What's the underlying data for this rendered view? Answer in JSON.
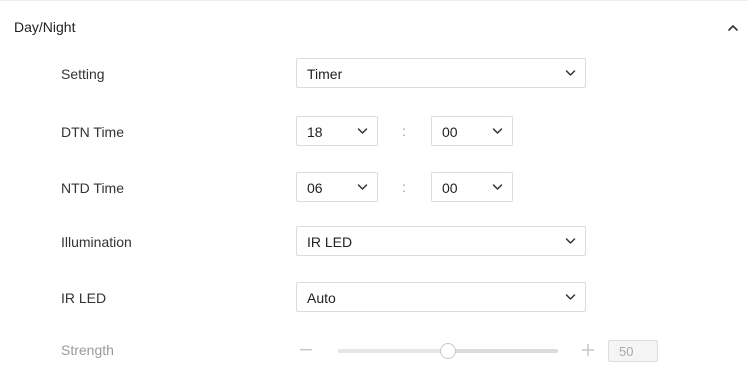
{
  "section": {
    "title": "Day/Night",
    "expanded": true,
    "icon": "chevron-up-icon"
  },
  "setting": {
    "label": "Setting",
    "value": "Timer"
  },
  "dtn_time": {
    "label": "DTN Time",
    "hour": "18",
    "minute": "00",
    "separator": ":"
  },
  "ntd_time": {
    "label": "NTD Time",
    "hour": "06",
    "minute": "00",
    "separator": ":"
  },
  "illumination": {
    "label": "Illumination",
    "value": "IR LED"
  },
  "ir_led": {
    "label": "IR LED",
    "value": "Auto"
  },
  "strength": {
    "label": "Strength",
    "value": "50",
    "min": 0,
    "max": 100,
    "level": 0.5,
    "disabled": true,
    "minus_icon": "minus-icon",
    "plus_icon": "plus-icon"
  },
  "colors": {
    "border": "#dcdcdc",
    "disabled_text": "#9a9a9a",
    "chevron": "#333333"
  }
}
